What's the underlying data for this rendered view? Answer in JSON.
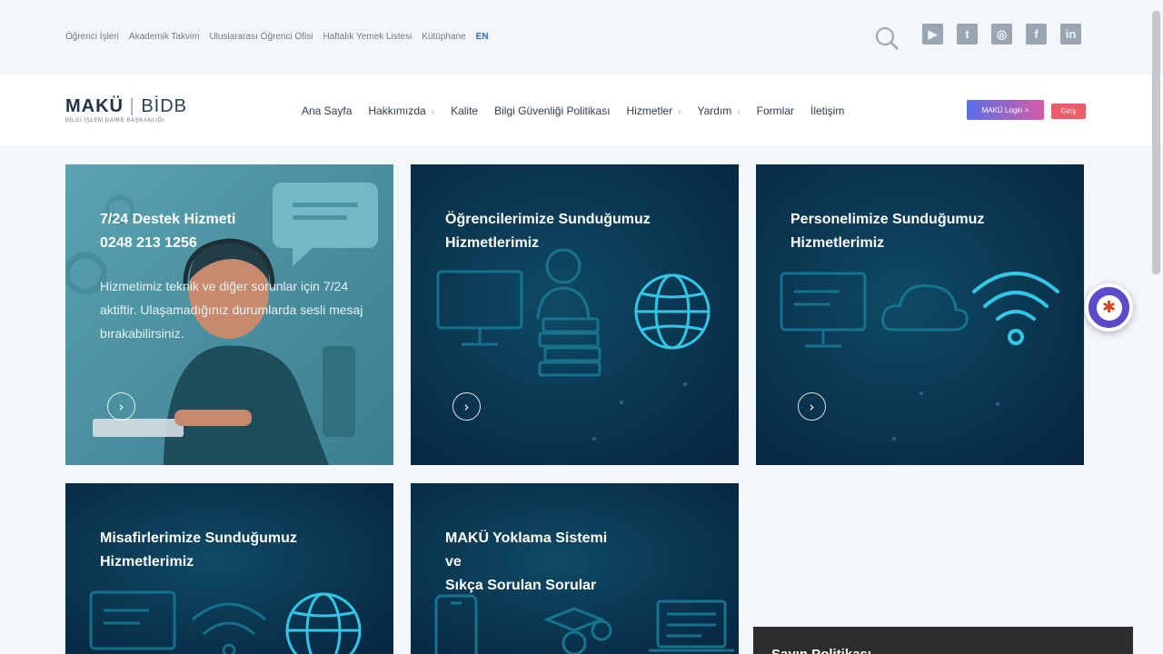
{
  "topbar": {
    "links": [
      "Öğrenci İşleri",
      "Akademik Takvim",
      "Uluslararası Öğrenci Ofisi",
      "Haftalık Yemek Listesi",
      "Kütüphane"
    ],
    "lang": "EN",
    "socials": [
      "youtube-icon",
      "twitter-icon",
      "instagram-icon",
      "facebook-icon",
      "linkedin-icon"
    ]
  },
  "logo": {
    "main": "MAKÜ",
    "bidb": "BİDB",
    "sub": "BİLGİ İŞLEM DAİRE BAŞKANLIĞI"
  },
  "nav": {
    "items": [
      {
        "label": "Ana Sayfa",
        "caret": false
      },
      {
        "label": "Hakkımızda",
        "caret": true
      },
      {
        "label": "Kalite",
        "caret": false
      },
      {
        "label": "Bilgi Güvenliği Politikası",
        "caret": false
      },
      {
        "label": "Hizmetler",
        "caret": true
      },
      {
        "label": "Yardım",
        "caret": true
      },
      {
        "label": "Formlar",
        "caret": false
      },
      {
        "label": "İletişim",
        "caret": false
      }
    ],
    "caret_glyph": "›",
    "badge_grad": "MAKÜ Login >",
    "badge_red": "Giriş"
  },
  "cards": [
    {
      "title": "7/24 Destek Hizmeti\n0248 213 1256",
      "desc": "Hizmetimiz teknik ve diğer sorunlar için 7/24 aktiftir. Ulaşamadığınız durumlarda sesli mesaj bırakabilirsiniz."
    },
    {
      "title": "Öğrencilerimize Sunduğumuz\nHizmetlerimiz",
      "desc": ""
    },
    {
      "title": "Personelimize Sunduğumuz\nHizmetlerimiz",
      "desc": ""
    },
    {
      "title": "Misafirlerimize Sunduğumuz\nHizmetlerimiz",
      "desc": ""
    },
    {
      "title": "MAKÜ Yoklama Sistemi\nve\nSıkça Sorulan Sorular",
      "desc": ""
    }
  ],
  "arrow_glyph": "›",
  "dark_panel": {
    "title": "Sayın Politikası"
  },
  "colors": {
    "accent_blue": "#3a69c8",
    "card_dark": "#0a3550",
    "card_teal": "#4b919f",
    "access_purple": "#5a4cc8"
  }
}
